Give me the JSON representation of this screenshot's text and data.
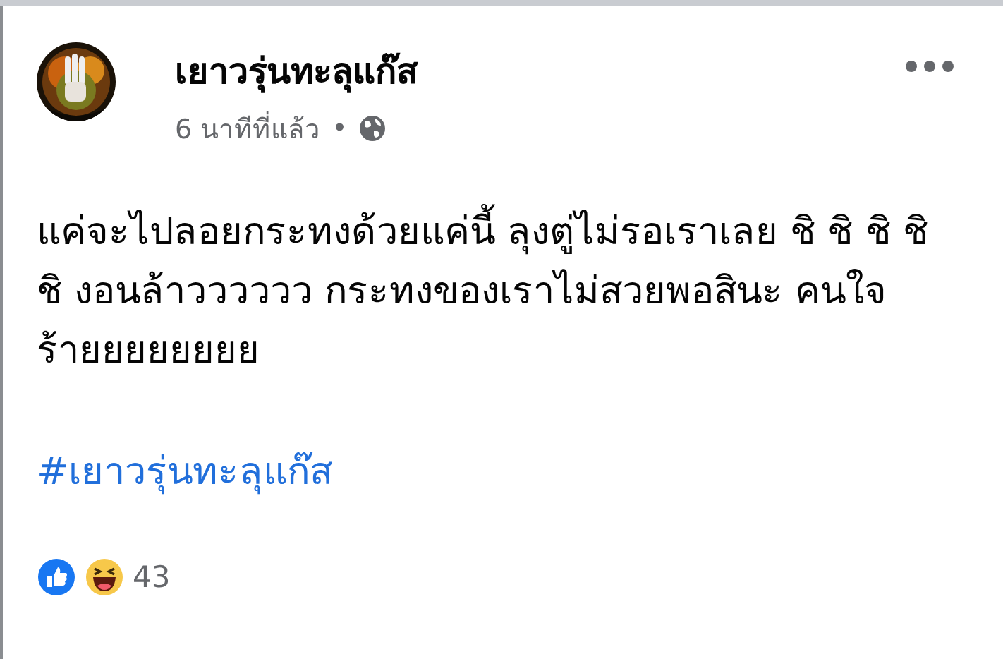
{
  "post": {
    "author": "เยาวรุ่นทะลุแก๊ส",
    "time": "6 นาทีที่แล้ว",
    "separator": "•",
    "text": "แค่จะไปลอยกระทงด้วยแค่นี้ ลุงตู่ไม่รอเราเลย ชิ ชิ ชิ ชิ ชิ งอนล้าวววววว กระทงของเราไม่สวยพอสินะ คนใจร้ายยยยยยยย",
    "hashtag": "#เยาวรุ่นทะลุแก๊ส",
    "reaction_count": "43"
  }
}
